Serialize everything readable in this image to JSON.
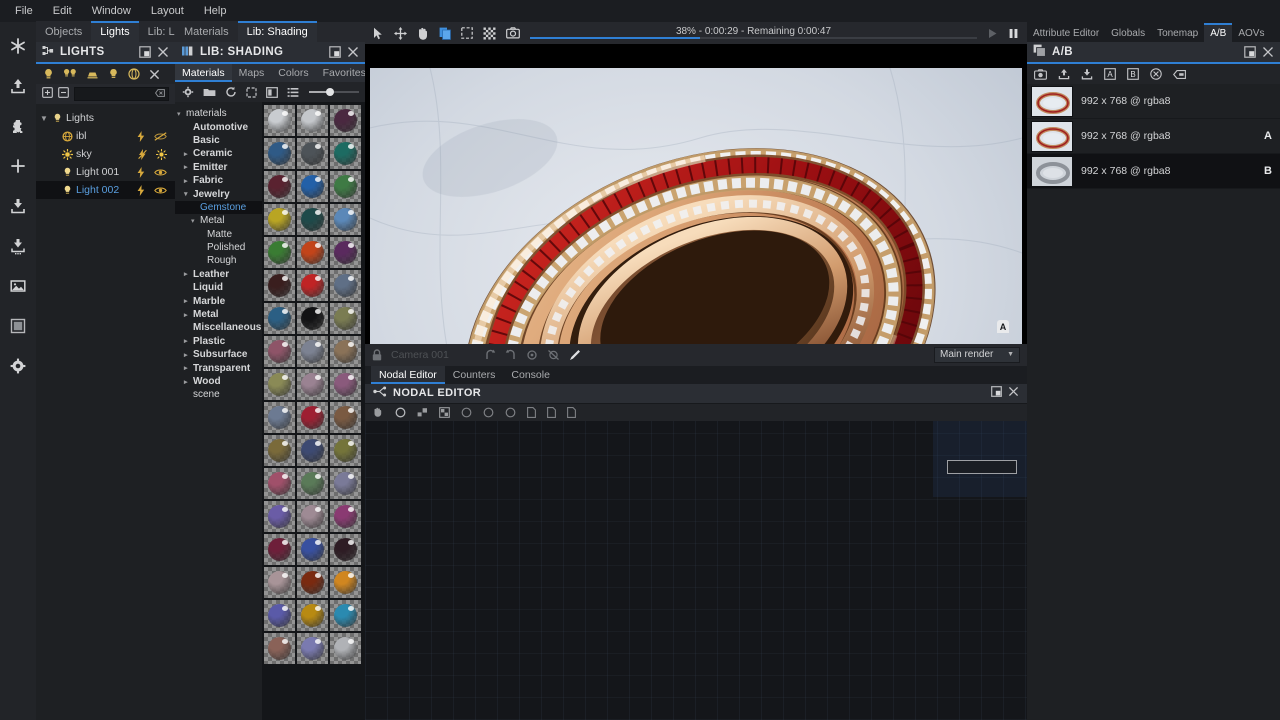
{
  "menu": {
    "items": [
      "File",
      "Edit",
      "Window",
      "Layout",
      "Help"
    ]
  },
  "rail": {
    "items": [
      {
        "name": "asterisk-icon"
      },
      {
        "name": "export-icon"
      },
      {
        "name": "plugin-icon"
      },
      {
        "name": "add-icon"
      },
      {
        "name": "import-icon"
      },
      {
        "name": "import-batch-icon"
      },
      {
        "name": "image-icon"
      },
      {
        "name": "render-region-icon"
      },
      {
        "name": "settings-gear-icon"
      }
    ]
  },
  "lights_panel": {
    "tabs": [
      {
        "label": "Objects",
        "active": false
      },
      {
        "label": "Lights",
        "active": true
      },
      {
        "label": "Lib: Lighting",
        "active": false
      }
    ],
    "title": "LIGHTS",
    "toolbar": [
      "point-light-icon",
      "multi-light-icon",
      "area-light-icon",
      "spot-light-icon",
      "ibl-light-icon",
      "delete-light-icon"
    ],
    "search_value": "",
    "search_placeholder": "",
    "tree": {
      "root_label": "Lights",
      "items": [
        {
          "label": "ibl",
          "icon": "ibl-icon",
          "selected": false,
          "visible": false
        },
        {
          "label": "sky",
          "icon": "sky-icon",
          "selected": false,
          "visible": true
        },
        {
          "label": "Light 001",
          "icon": "bulb-icon",
          "selected": false,
          "visible": true
        },
        {
          "label": "Light 002",
          "icon": "bulb-icon",
          "selected": true,
          "visible": true
        }
      ]
    }
  },
  "lib_panel": {
    "tabs": [
      {
        "label": "Materials",
        "active": false
      },
      {
        "label": "Lib: Shading",
        "active": true
      }
    ],
    "title": "LIB: SHADING",
    "sub_tabs": [
      {
        "label": "Materials",
        "active": true
      },
      {
        "label": "Maps",
        "active": false
      },
      {
        "label": "Colors",
        "active": false
      },
      {
        "label": "Favorites",
        "active": false
      }
    ],
    "toolbar": [
      "gear-icon",
      "folder-icon",
      "refresh-icon",
      "frame-icon",
      "thumbnail-icon",
      "list-icon"
    ],
    "zoom_slider_value": 35,
    "tree": [
      {
        "label": "materials",
        "depth": 0,
        "caret": "down",
        "bold": false,
        "selected": false
      },
      {
        "label": "Automotive",
        "depth": 1,
        "caret": "none",
        "bold": true,
        "selected": false
      },
      {
        "label": "Basic",
        "depth": 1,
        "caret": "none",
        "bold": true,
        "selected": false
      },
      {
        "label": "Ceramic",
        "depth": 1,
        "caret": "right",
        "bold": true,
        "selected": false
      },
      {
        "label": "Emitter",
        "depth": 1,
        "caret": "right",
        "bold": true,
        "selected": false
      },
      {
        "label": "Fabric",
        "depth": 1,
        "caret": "right",
        "bold": true,
        "selected": false
      },
      {
        "label": "Jewelry",
        "depth": 1,
        "caret": "down",
        "bold": true,
        "selected": false
      },
      {
        "label": "Gemstone",
        "depth": 2,
        "caret": "none",
        "bold": false,
        "selected": true
      },
      {
        "label": "Metal",
        "depth": 2,
        "caret": "down",
        "bold": false,
        "selected": false
      },
      {
        "label": "Matte",
        "depth": 3,
        "caret": "none",
        "bold": false,
        "selected": false
      },
      {
        "label": "Polished",
        "depth": 3,
        "caret": "none",
        "bold": false,
        "selected": false
      },
      {
        "label": "Rough",
        "depth": 3,
        "caret": "none",
        "bold": false,
        "selected": false
      },
      {
        "label": "Leather",
        "depth": 1,
        "caret": "right",
        "bold": true,
        "selected": false
      },
      {
        "label": "Liquid",
        "depth": 1,
        "caret": "none",
        "bold": true,
        "selected": false
      },
      {
        "label": "Marble",
        "depth": 1,
        "caret": "right",
        "bold": true,
        "selected": false
      },
      {
        "label": "Metal",
        "depth": 1,
        "caret": "right",
        "bold": true,
        "selected": false
      },
      {
        "label": "Miscellaneous",
        "depth": 1,
        "caret": "none",
        "bold": true,
        "selected": false
      },
      {
        "label": "Plastic",
        "depth": 1,
        "caret": "right",
        "bold": true,
        "selected": false
      },
      {
        "label": "Subsurface",
        "depth": 1,
        "caret": "right",
        "bold": true,
        "selected": false
      },
      {
        "label": "Transparent",
        "depth": 1,
        "caret": "right",
        "bold": true,
        "selected": false
      },
      {
        "label": "Wood",
        "depth": 1,
        "caret": "right",
        "bold": true,
        "selected": false
      },
      {
        "label": "scene",
        "depth": 1,
        "caret": "none",
        "bold": false,
        "selected": false
      }
    ],
    "swatch_colors": [
      "#c9ccd0",
      "#c4c7cb",
      "#4a2840",
      "#2f5a86",
      "#4d5358",
      "#1d6b62",
      "#5a2230",
      "#2360a8",
      "#3e7a44",
      "#b9a523",
      "#1e4a4a",
      "#5b88b8",
      "#3a7c33",
      "#c2441a",
      "#5a2a5e",
      "#3a1e1e",
      "#c02425",
      "#5f6f86",
      "#2b5f84",
      "#121214",
      "#7a7c52",
      "#8e5468",
      "#7c8292",
      "#8a7258",
      "#8a8a56",
      "#9a8292",
      "#8a5a7c",
      "#6c7a92",
      "#9e1f32",
      "#7a5a42",
      "#7a6a3a",
      "#3d4a72",
      "#74743a",
      "#a0506a",
      "#5a7a58",
      "#7a7a98",
      "#6a5ca6",
      "#9e8a94",
      "#8a3a72",
      "#6e1f3a",
      "#3850a0",
      "#2e1c24",
      "#a89498",
      "#7a2a10",
      "#d08620",
      "#5a5aa8",
      "#b88a12",
      "#2a8ab0",
      "#8a6258",
      "#7a7ab0",
      "#b0b2b6"
    ]
  },
  "render_view": {
    "toolbar_icons": [
      "select-arrow-icon",
      "move-icon",
      "pan-hand-icon",
      "copy-icon",
      "render-region-icon",
      "pixel-filter-icon",
      "snapshot-camera-icon"
    ],
    "progress_text": "38% - 0:00:29 - Remaining 0:00:47",
    "progress_percent": 38,
    "play_button": "play-icon",
    "pause_button": "pause-icon",
    "ab_badge": "A",
    "bottom": {
      "lock_icon": "lock-icon",
      "camera_name": "Camera 001",
      "icons": [
        "camera-out-icon",
        "camera-in-icon",
        "focus-icon",
        "lock-camera-icon",
        "pick-focus-icon"
      ],
      "render_target": "Main render"
    }
  },
  "nodal": {
    "tabs": [
      {
        "label": "Nodal Editor",
        "active": true
      },
      {
        "label": "Counters",
        "active": false
      },
      {
        "label": "Console",
        "active": false
      }
    ],
    "title": "NODAL EDITOR",
    "title_icon": "node-graph-icon",
    "toolbar": [
      "grab-icon",
      "circle-icon",
      "node-icon",
      "texture-node-icon",
      "circle-outline-icon",
      "circle-outline2-icon",
      "circle-outline3-icon",
      "page-icon",
      "page2-icon",
      "page3-icon"
    ]
  },
  "right_panel": {
    "tabs": [
      {
        "label": "Attribute Editor",
        "active": false
      },
      {
        "label": "Globals",
        "active": false
      },
      {
        "label": "Tonemap",
        "active": false
      },
      {
        "label": "A/B",
        "active": true
      },
      {
        "label": "AOVs",
        "active": false
      }
    ],
    "title": "A/B",
    "title_icon": "ab-compare-icon",
    "toolbar": [
      "snapshot-icon",
      "save-up-icon",
      "save-down-icon",
      "set-a-icon",
      "set-b-icon",
      "clear-icon",
      "delete-icon"
    ],
    "items": [
      {
        "label": "992 x 768 @ rgba8",
        "slot": "",
        "selected": false
      },
      {
        "label": "992 x 768 @ rgba8",
        "slot": "A",
        "selected": false
      },
      {
        "label": "992 x 768 @ rgba8",
        "slot": "B",
        "selected": true
      }
    ]
  },
  "colors": {
    "accent_blue": "#2f7fd4",
    "panel_bg": "#26282d",
    "tree_bg": "#1e2023",
    "selected_text": "#5a9fe0",
    "gold_icon": "#d8b95c"
  }
}
